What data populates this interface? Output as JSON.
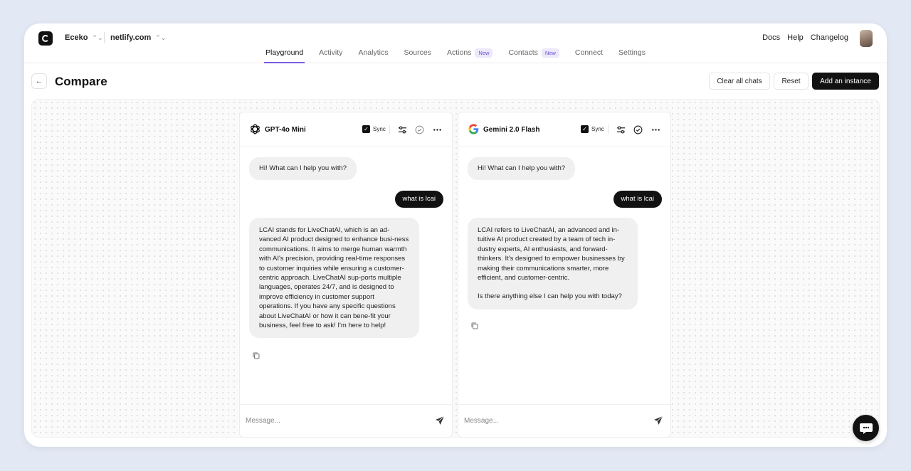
{
  "app": {
    "workspace": "Eceko",
    "site": "netlify.com",
    "top_links": [
      "Docs",
      "Help",
      "Changelog"
    ]
  },
  "nav": {
    "tabs": [
      {
        "label": "Playground",
        "active": true
      },
      {
        "label": "Activity"
      },
      {
        "label": "Analytics"
      },
      {
        "label": "Sources"
      },
      {
        "label": "Actions",
        "badge": "New"
      },
      {
        "label": "Contacts",
        "badge": "New"
      },
      {
        "label": "Connect"
      },
      {
        "label": "Settings"
      }
    ]
  },
  "header": {
    "title": "Compare",
    "clear_label": "Clear all chats",
    "reset_label": "Reset",
    "add_label": "Add an instance"
  },
  "panels": [
    {
      "model": "GPT-4o Mini",
      "icon": "openai-icon",
      "sync_label": "Sync",
      "greeting": "Hi! What can I help you with?",
      "user_message": "what is lcai",
      "response": "LCAI stands for LiveChatAI, which is an ad-vanced AI product designed to enhance busi-ness communications. It aims to merge human warmth with AI's precision, providing real-time responses to customer inquiries while ensuring a customer-centric approach. LiveChatAI sup-ports multiple languages, operates 24/7, and is designed to improve efficiency in customer support operations. If you have any specific questions about LiveChatAI or how it can bene-fit your business, feel free to ask! I'm here to help!",
      "placeholder": "Message..."
    },
    {
      "model": "Gemini 2.0 Flash",
      "icon": "google-icon",
      "sync_label": "Sync",
      "greeting": "Hi! What can I help you with?",
      "user_message": "what is lcai",
      "response": "LCAI refers to LiveChatAI, an advanced and in-tuitive AI product created by a team of tech in-dustry experts, AI enthusiasts, and forward-thinkers. It's designed to empower businesses by making their communications smarter, more efficient, and customer-centric.",
      "response_followup": "Is there anything else I can help you with today?",
      "placeholder": "Message..."
    }
  ],
  "colors": {
    "accent": "#7c5cdb",
    "dark": "#121212",
    "bubble_bg": "#f0f0f1"
  }
}
